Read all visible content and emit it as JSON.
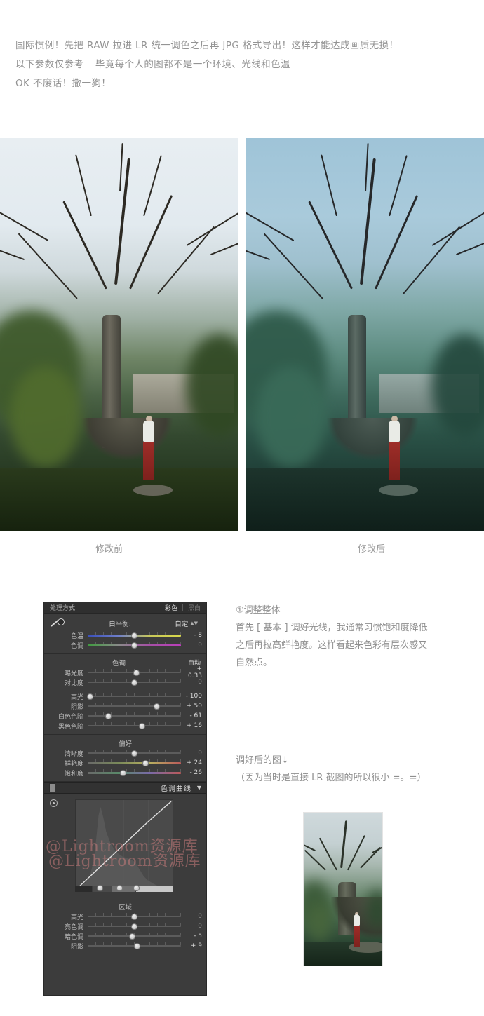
{
  "intro": {
    "lines": [
      "国际惯例！先把 RAW 拉进 LR 统一调色之后再 JPG 格式导出！这样才能达成画质无损！",
      "以下参数仅参考 – 毕竟每个人的图都不是一个环境、光线和色温",
      "OK 不废话！撒一狗！"
    ]
  },
  "compare": {
    "before_caption": "修改前",
    "after_caption": "修改后",
    "before_alt": "园林古树与红裙人像原图",
    "after_alt": "园林古树与红裙人像调色后"
  },
  "lightroom": {
    "treatment": {
      "label": "处理方式:",
      "color_option": "彩色",
      "bw_option": "黑白"
    },
    "white_balance": {
      "eyedropper_icon": "eyedropper-icon",
      "title": "白平衡:",
      "value": "自定",
      "sliders": [
        {
          "label": "色温",
          "value": "- 8",
          "pos": 50,
          "track": "grad-temp"
        },
        {
          "label": "色调",
          "value": "0",
          "pos": 50,
          "track": "grad-tint"
        }
      ]
    },
    "tone": {
      "title": "色调",
      "auto": "自动",
      "sliders": [
        {
          "label": "曝光度",
          "value": "+ 0.33",
          "pos": 52,
          "track": ""
        },
        {
          "label": "对比度",
          "value": "0",
          "pos": 50,
          "track": ""
        },
        {
          "label": "高光",
          "value": "- 100",
          "pos": 2,
          "track": ""
        },
        {
          "label": "阴影",
          "value": "+ 50",
          "pos": 74,
          "track": ""
        },
        {
          "label": "白色色阶",
          "value": "- 61",
          "pos": 21,
          "track": ""
        },
        {
          "label": "黑色色阶",
          "value": "+ 16",
          "pos": 58,
          "track": ""
        }
      ]
    },
    "presence": {
      "title": "偏好",
      "sliders": [
        {
          "label": "清晰度",
          "value": "0",
          "pos": 50,
          "track": ""
        },
        {
          "label": "鲜艳度",
          "value": "+ 24",
          "pos": 62,
          "track": "grad-vib"
        },
        {
          "label": "饱和度",
          "value": "- 26",
          "pos": 38,
          "track": "grad-sat"
        }
      ]
    },
    "tone_curve": {
      "panel_title": "色调曲线",
      "caret": "▼",
      "target_icon": "target-adjust-icon",
      "region_title": "区域",
      "sliders": [
        {
          "label": "高光",
          "value": "0",
          "pos": 50,
          "track": ""
        },
        {
          "label": "亮色调",
          "value": "0",
          "pos": 50,
          "track": ""
        },
        {
          "label": "暗色调",
          "value": "- 5",
          "pos": 48,
          "track": ""
        },
        {
          "label": "阴影",
          "value": "+ 9",
          "pos": 53,
          "track": ""
        }
      ],
      "split_knobs": [
        25,
        45,
        62
      ]
    },
    "watermark": "@Lightroom资源库"
  },
  "notes": {
    "heading": "①调整整体",
    "body_lines": [
      "首先 [ 基本 ] 调好光线，我通常习惯饱和度降低",
      "之后再拉高鲜艳度。这样看起来色彩有层次感又",
      "自然点。"
    ],
    "result_lines": [
      "调好后的图↓",
      "（因为当时是直接 LR 截图的所以很小 =。=）"
    ],
    "thumb_alt": "调色后的 LR 截图缩略图"
  },
  "colors": {
    "panel_bg": "#3c3c3c",
    "panel_header_bg": "#2f2f2f",
    "text_gray": "#8f8f8f",
    "watermark_red": "#c77b7b",
    "skirt_red": "#9e2d28"
  }
}
